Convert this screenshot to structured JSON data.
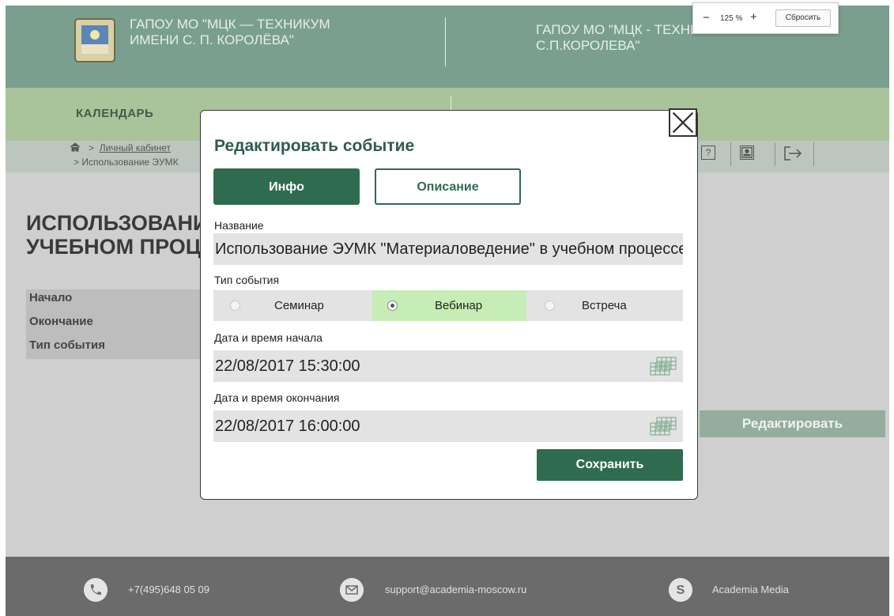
{
  "header": {
    "org_name_left": "ГАПОУ МО \"МЦК — ТЕХНИКУМ ИМЕНИ С. П. КОРОЛЁВА\"",
    "org_name_right": "ГАПОУ МО \"МЦК - ТЕХНИКУМ ИМЕНИ С.П.КОРОЛЕВА\""
  },
  "zoom": {
    "minus": "−",
    "value": "125 %",
    "plus": "+",
    "reset_label": "Сбросить"
  },
  "nav": {
    "calendar_label": "КАЛЕНДАРЬ"
  },
  "breadcrumb": {
    "home_icon": "home-icon",
    "link": "Личный кабинет",
    "current": "Использование ЭУМК"
  },
  "toolbar_icons": [
    "help-icon",
    "profile-icon",
    "logout-icon"
  ],
  "page": {
    "heading_line1": "ИСПОЛЬЗОВАНИЕ",
    "heading_line2": "УЧЕБНОМ ПРОЦЕССЕ",
    "info_labels": [
      "Начало",
      "Окончание",
      "Тип события"
    ],
    "edit_button": "Редактировать"
  },
  "modal": {
    "title": "Редактировать событие",
    "tabs": [
      {
        "label": "Инфо",
        "active": true
      },
      {
        "label": "Описание",
        "active": false
      }
    ],
    "name_label": "Название",
    "name_value": "Использование ЭУМК \"Материаловедение\" в учебном процессе",
    "type_label": "Тип события",
    "type_options": [
      {
        "label": "Семинар",
        "selected": false
      },
      {
        "label": "Вебинар",
        "selected": true
      },
      {
        "label": "Встреча",
        "selected": false
      }
    ],
    "start_label": "Дата и время начала",
    "start_value": "22/08/2017 15:30:00",
    "end_label": "Дата и время окончания",
    "end_value": "22/08/2017 16:00:00",
    "save_button": "Сохранить",
    "close_icon": "close-icon",
    "calendar_icon": "calendar-grid-icon"
  },
  "footer": {
    "phone": "+7(495)648 05 09",
    "email": "support@academia-moscow.ru",
    "skype": "Academia Media"
  },
  "colors": {
    "header_bg": "#7a9f8e",
    "calendar_bar_bg": "#a9c39a",
    "accent_green": "#2f6b4f",
    "selected_option_bg": "#c6edb5",
    "footer_bg": "#6b6b6b"
  }
}
